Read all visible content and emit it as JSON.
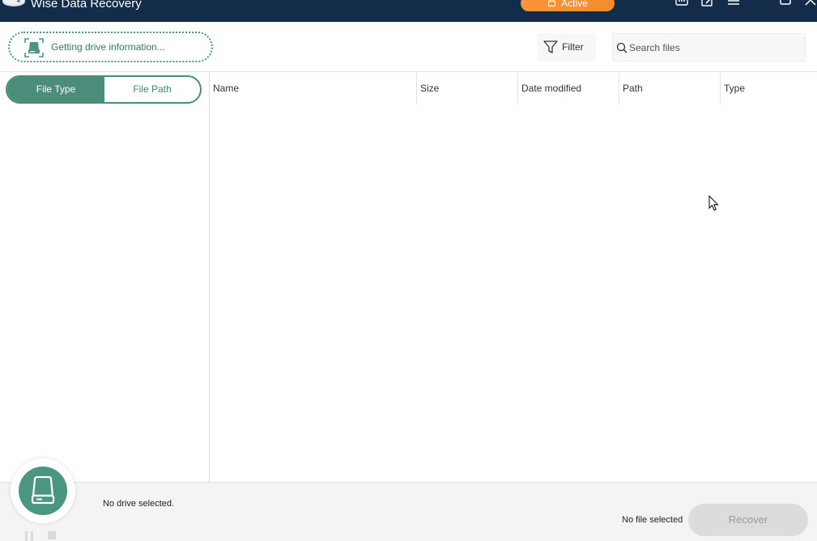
{
  "window": {
    "title": "Wise Data Recovery",
    "active_label": "Active",
    "icons": [
      "feedback-icon",
      "edit-icon",
      "menu-icon",
      "minimize-icon",
      "maximize-icon",
      "close-icon"
    ]
  },
  "toolbar": {
    "drive_status": "Getting drive information...",
    "filter_label": "Filter",
    "search_placeholder": "Search files"
  },
  "left_panel": {
    "tabs": [
      {
        "label": "File Type",
        "active": true
      },
      {
        "label": "File Path",
        "active": false
      }
    ]
  },
  "table": {
    "columns": [
      "Name",
      "Size",
      "Date modified",
      "Path",
      "Type"
    ],
    "rows": []
  },
  "footer": {
    "drive_text": "No drive selected.",
    "file_text": "No file selected",
    "recover_label": "Recover"
  },
  "colors": {
    "titlebar": "#132c4a",
    "accent": "#4b8c7b",
    "active_button": "#f7953b"
  }
}
